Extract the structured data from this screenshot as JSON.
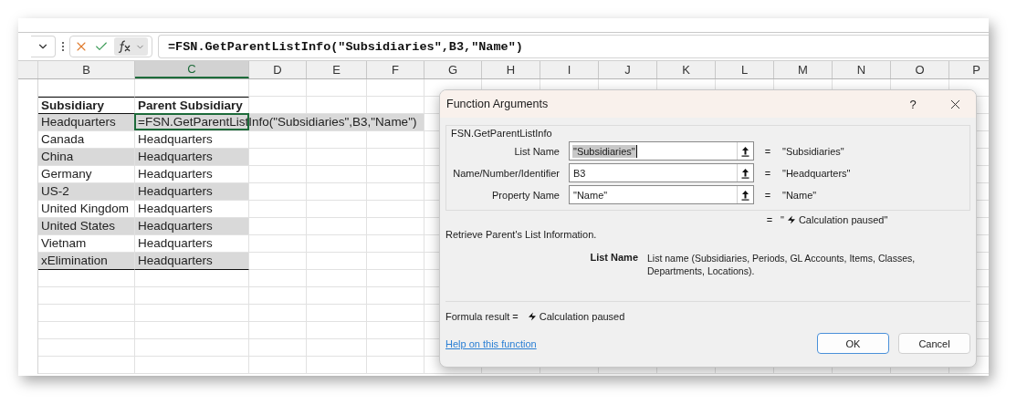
{
  "formula_bar": {
    "formula": "=FSN.GetParentListInfo(\"Subsidiaries\",B3,\"Name\")"
  },
  "columns": [
    {
      "label": "B",
      "selected": false
    },
    {
      "label": "C",
      "selected": true
    },
    {
      "label": "D",
      "selected": false
    },
    {
      "label": "E",
      "selected": false
    },
    {
      "label": "F",
      "selected": false
    },
    {
      "label": "G",
      "selected": false
    },
    {
      "label": "H",
      "selected": false
    },
    {
      "label": "I",
      "selected": false
    },
    {
      "label": "J",
      "selected": false
    },
    {
      "label": "K",
      "selected": false
    },
    {
      "label": "L",
      "selected": false
    },
    {
      "label": "M",
      "selected": false
    },
    {
      "label": "N",
      "selected": false
    },
    {
      "label": "O",
      "selected": false
    },
    {
      "label": "P",
      "selected": false
    }
  ],
  "table": {
    "headers": [
      "Subsidiary",
      "Parent Subsidiary"
    ],
    "rows": [
      {
        "subsidiary": "Headquarters",
        "parent": "=FSN.GetParentListInfo(\"Subsidiaries\",B3,\"Name\")",
        "selected": true
      },
      {
        "subsidiary": "Canada",
        "parent": "Headquarters",
        "selected": false
      },
      {
        "subsidiary": "China",
        "parent": "Headquarters",
        "selected": false
      },
      {
        "subsidiary": "Germany",
        "parent": "Headquarters",
        "selected": false
      },
      {
        "subsidiary": "US-2",
        "parent": "Headquarters",
        "selected": false
      },
      {
        "subsidiary": "United Kingdom",
        "parent": "Headquarters",
        "selected": false
      },
      {
        "subsidiary": "United States",
        "parent": "Headquarters",
        "selected": false
      },
      {
        "subsidiary": "Vietnam",
        "parent": "Headquarters",
        "selected": false
      },
      {
        "subsidiary": "xElimination",
        "parent": "Headquarters",
        "selected": false
      }
    ]
  },
  "dialog": {
    "title": "Function Arguments",
    "help": "?",
    "function_name": "FSN.GetParentListInfo",
    "arguments": [
      {
        "label": "List Name",
        "value": "\"Subsidiaries\"",
        "selected": true,
        "equals": "=",
        "result": "\"Subsidiaries\""
      },
      {
        "label": "Name/Number/Identifier",
        "value": "B3",
        "selected": false,
        "equals": "=",
        "result": "\"Headquarters\""
      },
      {
        "label": "Property Name",
        "value": "\"Name\"",
        "selected": false,
        "equals": "=",
        "result": "\"Name\""
      }
    ],
    "function_result": {
      "equals": "=",
      "open_quote": "\"",
      "text": "Calculation paused\""
    },
    "description": "Retrieve Parent's List Information.",
    "argument_help": {
      "name": "List Name",
      "text": "List name (Subsidiaries, Periods, GL Accounts, Items, Classes, Departments, Locations)."
    },
    "formula_result": {
      "label": "Formula result =",
      "value": "Calculation paused"
    },
    "help_link": "Help on this function",
    "buttons": [
      {
        "label": "OK",
        "default": true
      },
      {
        "label": "Cancel",
        "default": false
      }
    ]
  }
}
